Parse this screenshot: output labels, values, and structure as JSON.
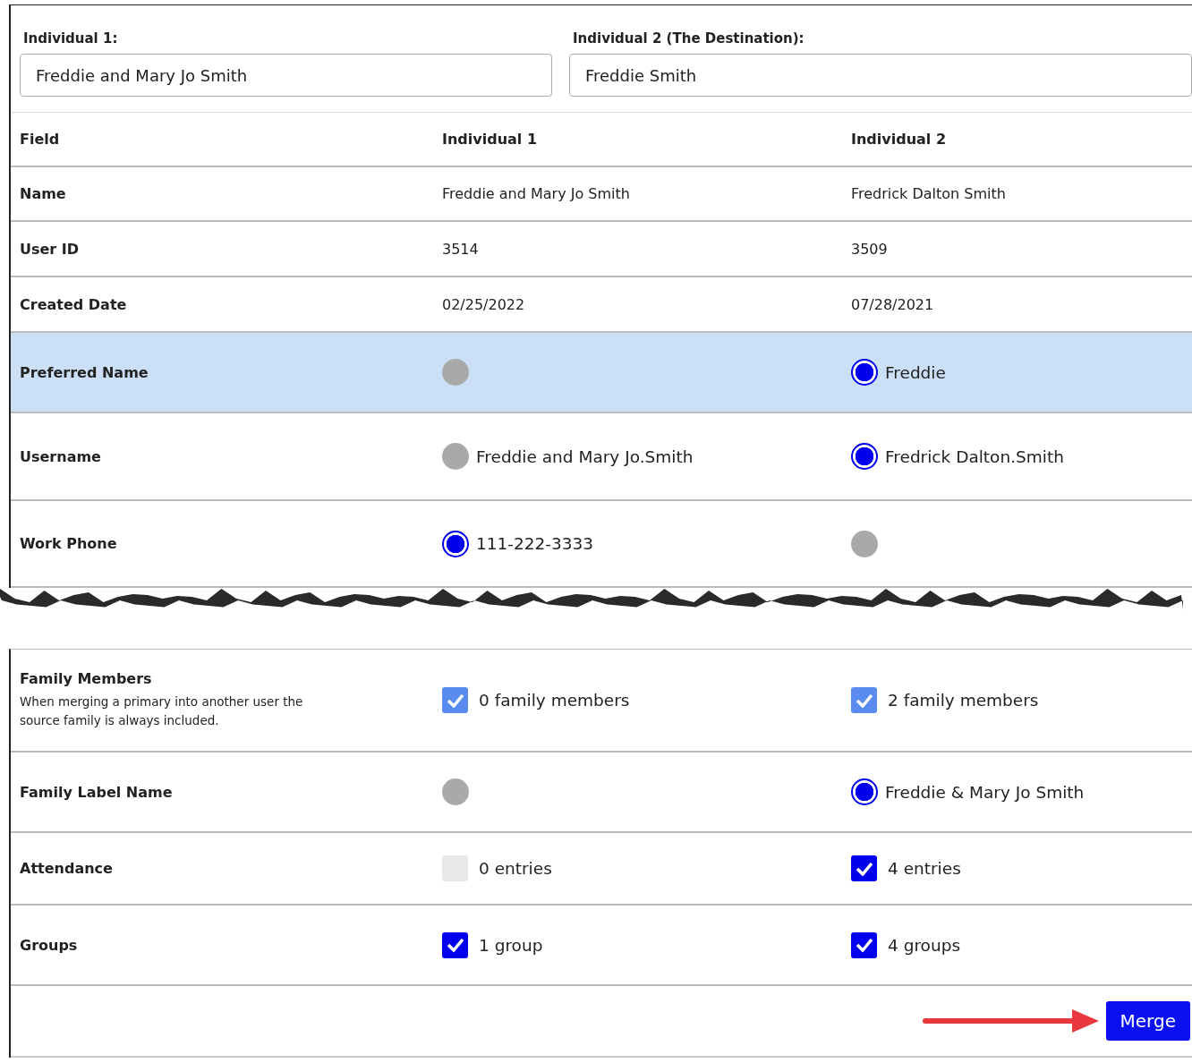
{
  "selectors": [
    {
      "label": "Individual 1:",
      "value": "Freddie and Mary Jo Smith"
    },
    {
      "label": "Individual 2 (The Destination):",
      "value": "Freddie Smith"
    }
  ],
  "table": {
    "columns": [
      "Field",
      "Individual 1",
      "Individual 2"
    ],
    "sections": [
      {
        "rows": [
          {
            "field": "Name",
            "highlighted": false,
            "cells": [
              {
                "kind": "text",
                "text": "Freddie and Mary Jo Smith"
              },
              {
                "kind": "text",
                "text": "Fredrick Dalton Smith"
              }
            ]
          },
          {
            "field": "User ID",
            "highlighted": false,
            "cells": [
              {
                "kind": "text",
                "text": "3514"
              },
              {
                "kind": "text",
                "text": "3509"
              }
            ]
          },
          {
            "field": "Created Date",
            "highlighted": false,
            "cells": [
              {
                "kind": "text",
                "text": "02/25/2022"
              },
              {
                "kind": "text",
                "text": "07/28/2021"
              }
            ]
          },
          {
            "field": "Preferred Name",
            "highlighted": true,
            "cells": [
              {
                "kind": "radio",
                "selected": false
              },
              {
                "kind": "radio",
                "selected": true,
                "text": "Freddie"
              }
            ]
          },
          {
            "field": "Username",
            "highlighted": false,
            "cells": [
              {
                "kind": "radio",
                "selected": false,
                "text": "Freddie and Mary Jo.Smith"
              },
              {
                "kind": "radio",
                "selected": true,
                "text": "Fredrick Dalton.Smith"
              }
            ]
          },
          {
            "field": "Work Phone",
            "highlighted": false,
            "cells": [
              {
                "kind": "radio",
                "selected": true,
                "text": "111-222-3333"
              },
              {
                "kind": "radio",
                "selected": false
              }
            ]
          }
        ]
      },
      {
        "rows": [
          {
            "field": "Family Members",
            "note": "When merging a primary into another user the source family is always included.",
            "highlighted": false,
            "cells": [
              {
                "kind": "checkbox",
                "checked": true,
                "disabled": true,
                "text": "0 family members"
              },
              {
                "kind": "checkbox",
                "checked": true,
                "disabled": true,
                "text": "2 family members"
              }
            ]
          },
          {
            "field": "Family Label Name",
            "highlighted": false,
            "cells": [
              {
                "kind": "radio",
                "selected": false
              },
              {
                "kind": "radio",
                "selected": true,
                "text": "Freddie & Mary Jo Smith"
              }
            ]
          },
          {
            "field": "Attendance",
            "highlighted": false,
            "cells": [
              {
                "kind": "checkbox",
                "checked": false,
                "disabled": true,
                "text": "0 entries"
              },
              {
                "kind": "checkbox",
                "checked": true,
                "disabled": false,
                "text": "4 entries"
              }
            ]
          },
          {
            "field": "Groups",
            "highlighted": false,
            "cells": [
              {
                "kind": "checkbox",
                "checked": true,
                "disabled": false,
                "text": "1 group"
              },
              {
                "kind": "checkbox",
                "checked": true,
                "disabled": false,
                "text": "4 groups"
              }
            ]
          }
        ]
      }
    ]
  },
  "merge_button": "Merge"
}
